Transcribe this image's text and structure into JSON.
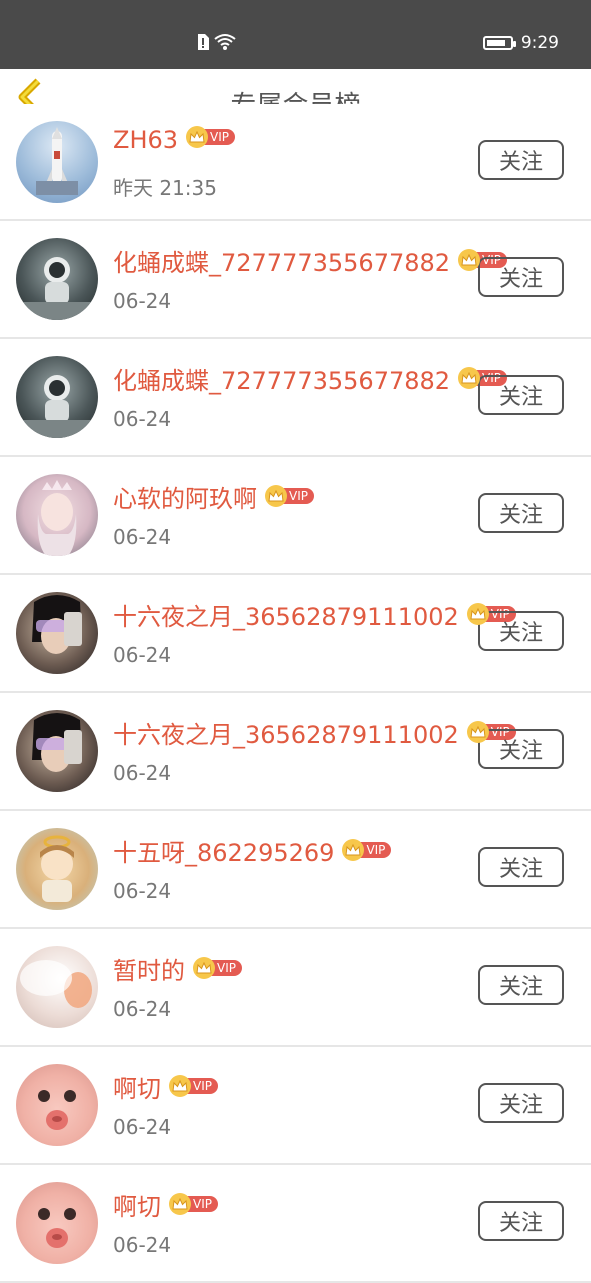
{
  "status_bar": {
    "time": "9:29"
  },
  "header": {
    "title": "专属会员榜"
  },
  "vip_label": "VIP",
  "members": [
    {
      "name": "ZH63",
      "time": "昨天 21:35",
      "follow": "关注",
      "avatar": "rocket"
    },
    {
      "name": "化蛹成蝶_727777355677882",
      "time": "06-24",
      "follow": "关注",
      "avatar": "astronaut"
    },
    {
      "name": "化蛹成蝶_727777355677882",
      "time": "06-24",
      "follow": "关注",
      "avatar": "astronaut"
    },
    {
      "name": "心软的阿玖啊",
      "time": "06-24",
      "follow": "关注",
      "avatar": "girl-crown"
    },
    {
      "name": "十六夜之月_36562879111002",
      "time": "06-24",
      "follow": "关注",
      "avatar": "girl-phone"
    },
    {
      "name": "十六夜之月_36562879111002",
      "time": "06-24",
      "follow": "关注",
      "avatar": "girl-phone"
    },
    {
      "name": "十五呀_862295269",
      "time": "06-24",
      "follow": "关注",
      "avatar": "cartoon-angel"
    },
    {
      "name": "暂时的",
      "time": "06-24",
      "follow": "关注",
      "avatar": "soft-pink"
    },
    {
      "name": "啊切",
      "time": "06-24",
      "follow": "关注",
      "avatar": "baby-face"
    },
    {
      "name": "啊切",
      "time": "06-24",
      "follow": "关注",
      "avatar": "baby-face"
    }
  ]
}
